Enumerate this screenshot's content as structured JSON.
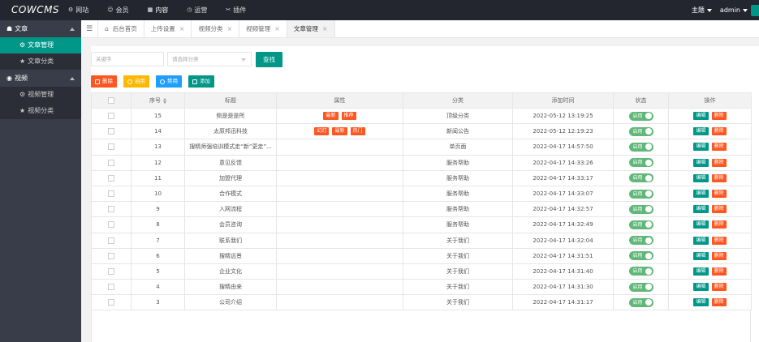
{
  "header": {
    "logo": "COWCMS",
    "nav": [
      {
        "label": "网站",
        "icon": "gear-icon",
        "glyph": "⚙"
      },
      {
        "label": "会员",
        "icon": "user-icon",
        "glyph": "☺"
      },
      {
        "label": "内容",
        "icon": "content-icon",
        "glyph": "▦"
      },
      {
        "label": "运营",
        "icon": "operations-icon",
        "glyph": "◷"
      },
      {
        "label": "插件",
        "icon": "plugin-icon",
        "glyph": "✂"
      }
    ],
    "theme_label": "主题",
    "user_label": "admin"
  },
  "sidebar": {
    "groups": [
      {
        "label": "文章",
        "icon": "article-icon",
        "glyph": "☗",
        "items": [
          {
            "label": "文章管理",
            "icon": "settings-icon",
            "glyph": "⚙",
            "active": true
          },
          {
            "label": "文章分类",
            "icon": "star-icon",
            "glyph": "★",
            "active": false
          }
        ]
      },
      {
        "label": "视频",
        "icon": "video-icon",
        "glyph": "◉",
        "items": [
          {
            "label": "视频管理",
            "icon": "settings-icon",
            "glyph": "⚙",
            "active": false
          },
          {
            "label": "视频分类",
            "icon": "star-icon",
            "glyph": "★",
            "active": false
          }
        ]
      }
    ]
  },
  "tabs": [
    {
      "label": "后台首页",
      "home": true,
      "closable": false,
      "active": false
    },
    {
      "label": "上传设置",
      "home": false,
      "closable": true,
      "active": false
    },
    {
      "label": "视频分类",
      "home": false,
      "closable": true,
      "active": false
    },
    {
      "label": "视频管理",
      "home": false,
      "closable": true,
      "active": false
    },
    {
      "label": "文章管理",
      "home": false,
      "closable": true,
      "active": true
    }
  ],
  "search": {
    "keyword_placeholder": "关键字",
    "category_placeholder": "请选择分类",
    "button_label": "查找"
  },
  "actions": {
    "delete_label": "删除",
    "enable_label": "启用",
    "disable_label": "禁用",
    "add_label": "添加"
  },
  "table": {
    "headers": [
      "序号",
      "标题",
      "属性",
      "分类",
      "添加时间",
      "状态",
      "操作"
    ],
    "status_label": "启用",
    "edit_label": "编辑",
    "delete_label": "删除",
    "rows": [
      {
        "id": "15",
        "title": "侧是是是所",
        "attrs": [
          "最新",
          "推荐"
        ],
        "category": "顶级分类",
        "time": "2022-05-12 13:19:25"
      },
      {
        "id": "14",
        "title": "太原邦迅科技",
        "attrs": [
          "幻灯",
          "最新",
          "热门"
        ],
        "category": "新闻公告",
        "time": "2022-05-12 12:19:23"
      },
      {
        "id": "13",
        "title": "搜精师强培训模式走“新”更走”...",
        "attrs": [],
        "category": "单页面",
        "time": "2022-04-17 14:57:50"
      },
      {
        "id": "12",
        "title": "意见反馈",
        "attrs": [],
        "category": "服务帮助",
        "time": "2022-04-17 14:33:26"
      },
      {
        "id": "11",
        "title": "加盟代理",
        "attrs": [],
        "category": "服务帮助",
        "time": "2022-04-17 14:33:17"
      },
      {
        "id": "10",
        "title": "合作模式",
        "attrs": [],
        "category": "服务帮助",
        "time": "2022-04-17 14:33:07"
      },
      {
        "id": "9",
        "title": "入网流程",
        "attrs": [],
        "category": "服务帮助",
        "time": "2022-04-17 14:32:57"
      },
      {
        "id": "8",
        "title": "会员咨询",
        "attrs": [],
        "category": "服务帮助",
        "time": "2022-04-17 14:32:49"
      },
      {
        "id": "7",
        "title": "联系我们",
        "attrs": [],
        "category": "关于我们",
        "time": "2022-04-17 14:32:04"
      },
      {
        "id": "6",
        "title": "搜精远景",
        "attrs": [],
        "category": "关于我们",
        "time": "2022-04-17 14:31:51"
      },
      {
        "id": "5",
        "title": "企业文化",
        "attrs": [],
        "category": "关于我们",
        "time": "2022-04-17 14:31:40"
      },
      {
        "id": "4",
        "title": "搜精由来",
        "attrs": [],
        "category": "关于我们",
        "time": "2022-04-17 14:31:30"
      },
      {
        "id": "3",
        "title": "公司介绍",
        "attrs": [],
        "category": "关于我们",
        "time": "2022-04-17 14:31:17"
      }
    ]
  },
  "colors": {
    "primary": "#009688",
    "danger": "#ff5722",
    "warning": "#ffb800",
    "info": "#1e9fff",
    "switch_on": "#5fb878",
    "header_bg": "#23262e",
    "sidebar_bg": "#393d49"
  }
}
